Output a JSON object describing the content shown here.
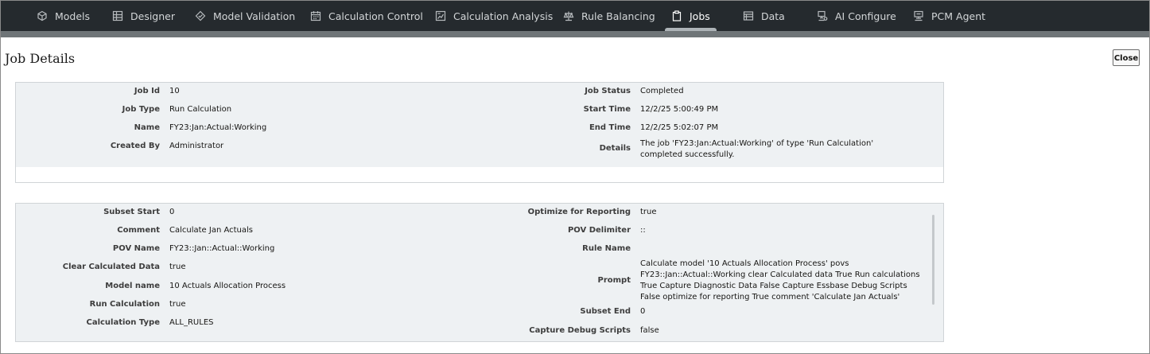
{
  "nav": {
    "items": [
      {
        "label": "Models",
        "icon": "cube-icon"
      },
      {
        "label": "Designer",
        "icon": "grid-icon"
      },
      {
        "label": "Model Validation",
        "icon": "validation-icon"
      },
      {
        "label": "Calculation Control",
        "icon": "calendar-icon"
      },
      {
        "label": "Calculation Analysis",
        "icon": "analysis-icon"
      },
      {
        "label": "Rule Balancing",
        "icon": "balance-icon"
      },
      {
        "label": "Jobs",
        "icon": "clipboard-icon",
        "active": true
      },
      {
        "label": "Data",
        "icon": "table-icon"
      },
      {
        "label": "AI Configure",
        "icon": "ai-config-icon"
      },
      {
        "label": "PCM Agent",
        "icon": "agent-icon"
      }
    ]
  },
  "page": {
    "title": "Job Details",
    "close_label": "Close"
  },
  "job_summary": {
    "job_id_label": "Job Id",
    "job_id": "10",
    "job_type_label": "Job Type",
    "job_type": "Run Calculation",
    "name_label": "Name",
    "name": "FY23:Jan:Actual:Working",
    "created_by_label": "Created By",
    "created_by": "Administrator",
    "job_status_label": "Job Status",
    "job_status": "Completed",
    "start_time_label": "Start Time",
    "start_time": "12/2/25 5:00:49 PM",
    "end_time_label": "End Time",
    "end_time": "12/2/25 5:02:07 PM",
    "details_label": "Details",
    "details": "The job 'FY23:Jan:Actual:Working' of type 'Run Calculation' completed successfully."
  },
  "job_params": {
    "subset_start_label": "Subset Start",
    "subset_start": "0",
    "comment_label": "Comment",
    "comment": "Calculate Jan Actuals",
    "pov_name_label": "POV Name",
    "pov_name": "FY23::Jan::Actual::Working",
    "clear_calc_label": "Clear Calculated Data",
    "clear_calc": "true",
    "model_name_label": "Model name",
    "model_name": "10 Actuals Allocation Process",
    "run_calc_label": "Run Calculation",
    "run_calc": "true",
    "calc_type_label": "Calculation Type",
    "calc_type": "ALL_RULES",
    "optimize_label": "Optimize for Reporting",
    "optimize": "true",
    "pov_delim_label": "POV Delimiter",
    "pov_delim": "::",
    "rule_name_label": "Rule Name",
    "rule_name": "",
    "prompt_label": "Prompt",
    "prompt": "Calculate model '10 Actuals Allocation Process' povs FY23::Jan::Actual::Working clear Calculated data True Run calculations True Capture Diagnostic Data False Capture Essbase Debug Scripts False optimize for reporting True comment 'Calculate Jan Actuals'",
    "subset_end_label": "Subset End",
    "subset_end": "0",
    "capture_debug_label": "Capture Debug Scripts",
    "capture_debug": "false"
  }
}
